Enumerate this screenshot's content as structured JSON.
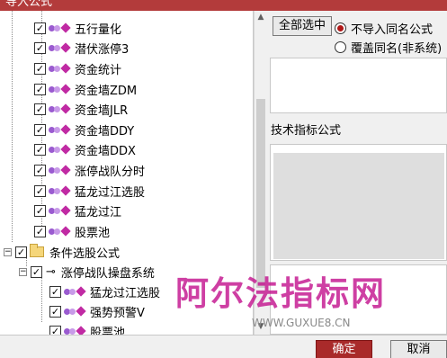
{
  "window": {
    "title": "导入公式"
  },
  "tree": {
    "items_group1": [
      {
        "label": "五行量化",
        "checked": "✓"
      },
      {
        "label": "潜伏涨停3",
        "checked": "✓"
      },
      {
        "label": "资金统计",
        "checked": "✓"
      },
      {
        "label": "资金墙ZDM",
        "checked": "✓"
      },
      {
        "label": "资金墙JLR",
        "checked": "✓"
      },
      {
        "label": "资金墙DDY",
        "checked": "✓"
      },
      {
        "label": "资金墙DDX",
        "checked": "✓"
      },
      {
        "label": "涨停战队分时",
        "checked": "✓"
      },
      {
        "label": "猛龙过江选股",
        "checked": "✓"
      },
      {
        "label": "猛龙过江",
        "checked": "✓"
      },
      {
        "label": "股票池",
        "checked": "✓"
      }
    ],
    "folder": {
      "label": "条件选股公式",
      "expander": "−",
      "checked": "✓"
    },
    "system": {
      "label": "涨停战队操盘系统",
      "expander": "−",
      "checked": "✓"
    },
    "items_group2": [
      {
        "label": "猛龙过江选股",
        "checked": "✓"
      },
      {
        "label": "强势预警V",
        "checked": "✓"
      },
      {
        "label": "股票池",
        "checked": "✓"
      }
    ]
  },
  "options": {
    "select_all_label": "全部选中",
    "radio_no_import": "不导入同名公式",
    "radio_overwrite": "覆盖同名(非系统)",
    "selected": "no_import"
  },
  "formula_panel": {
    "label": "技术指标公式"
  },
  "watermark": {
    "text": "阿尔法指标网",
    "url": "WWW.GUXUE8.CN"
  },
  "buttons": {
    "ok": "确定",
    "cancel": "取消"
  },
  "colors": {
    "title_bar": "#b33b3b",
    "ok_button": "#a92a2a",
    "watermark": "#c4168f",
    "radio_dot": "#b01818"
  },
  "icons": {
    "formula_icon": "diamond-formula-icon",
    "folder_icon": "folder-icon",
    "system_icon": "key-icon"
  }
}
